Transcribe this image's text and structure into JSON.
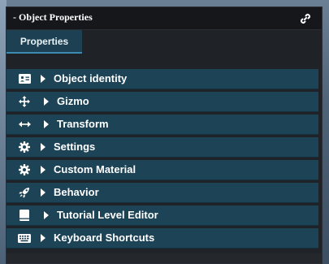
{
  "panel": {
    "title": "- Object Properties",
    "link_icon": "link-icon"
  },
  "tabs": [
    {
      "label": "Properties",
      "active": true
    }
  ],
  "items": [
    {
      "label": "Object identity",
      "icon": "id-card-icon"
    },
    {
      "label": "Gizmo",
      "icon": "move-arrows-icon"
    },
    {
      "label": "Transform",
      "icon": "horizontal-arrows-icon"
    },
    {
      "label": "Settings",
      "icon": "gear-icon"
    },
    {
      "label": "Custom Material",
      "icon": "gear-icon"
    },
    {
      "label": "Behavior",
      "icon": "rocket-icon"
    },
    {
      "label": "Tutorial Level Editor",
      "icon": "book-icon"
    },
    {
      "label": "Keyboard Shortcuts",
      "icon": "keyboard-icon"
    }
  ],
  "colors": {
    "panel_bg": "#1f2227",
    "item_bg": "#1c4356",
    "tab_bg": "#1d4152",
    "tab_accent": "#3d8bb0"
  }
}
